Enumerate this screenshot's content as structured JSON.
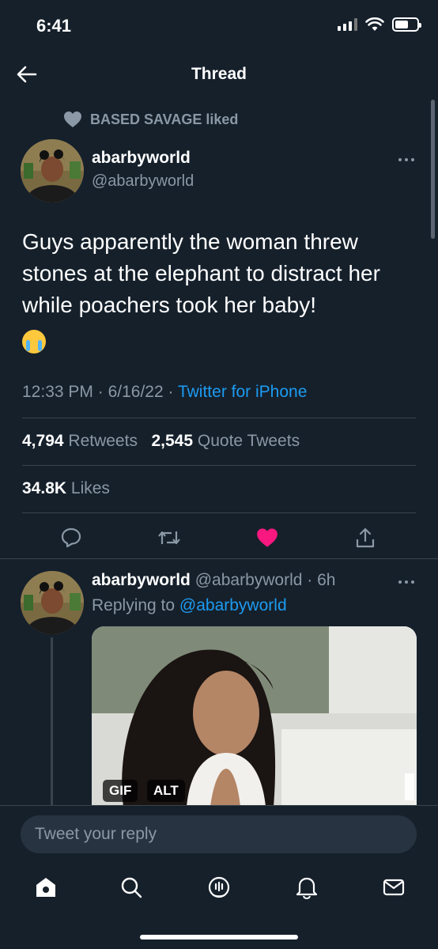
{
  "status_bar": {
    "time": "6:41"
  },
  "header": {
    "title": "Thread"
  },
  "social_context": {
    "text": "BASED SAVAGE liked"
  },
  "tweet": {
    "display_name": "abarbyworld",
    "handle": "@abarbyworld",
    "text": "Guys apparently the woman threw stones at the elephant to distract her while poachers took her baby!",
    "emoji": "loudly-crying-face",
    "time": "12:33 PM",
    "date": "6/16/22",
    "separator": "·",
    "source": "Twitter for iPhone",
    "retweets_count": "4,794",
    "retweets_label": "Retweets",
    "quotes_count": "2,545",
    "quotes_label": "Quote Tweets",
    "likes_count": "34.8K",
    "likes_label": "Likes",
    "liked": true
  },
  "reply": {
    "display_name": "abarbyworld",
    "handle_time": "@abarbyworld · 6h",
    "replying_prefix": "Replying to",
    "replying_to": "@abarbyworld",
    "media_badges": {
      "gif": "GIF",
      "alt": "ALT"
    }
  },
  "composer": {
    "placeholder": "Tweet your reply"
  },
  "tabs": [
    "home-icon",
    "search-icon",
    "spaces-icon",
    "notifications-icon",
    "messages-icon"
  ],
  "colors": {
    "background": "#15202b",
    "accent": "#1d9bf0",
    "like": "#f91880",
    "muted": "#8b98a5"
  }
}
